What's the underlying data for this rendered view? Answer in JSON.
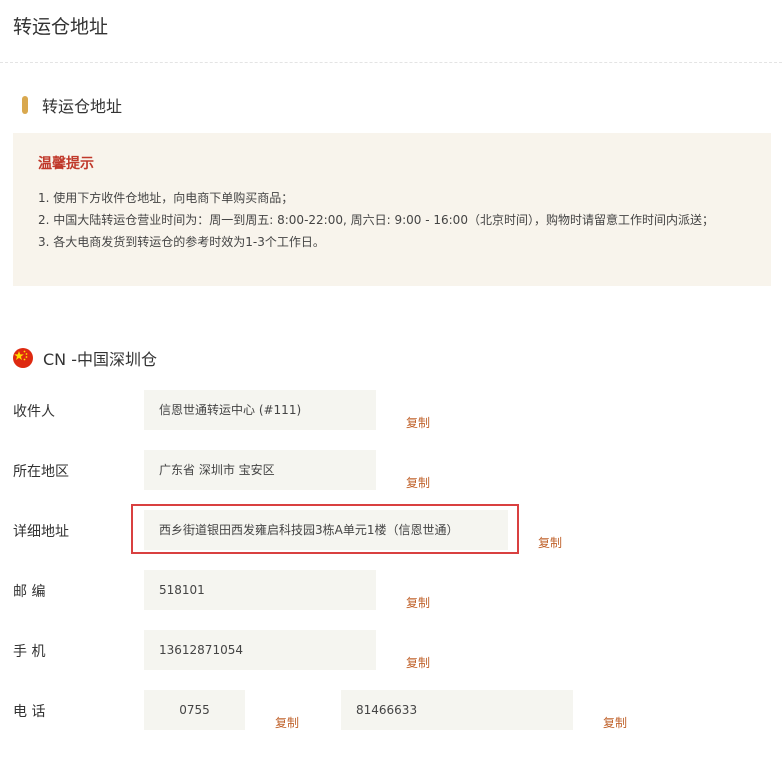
{
  "page": {
    "title": "转运仓地址"
  },
  "section": {
    "title": "转运仓地址"
  },
  "notice": {
    "title": "温馨提示",
    "lines": [
      "1. 使用下方收件仓地址，向电商下单购买商品；",
      "2. 中国大陆转运仓营业时间为：周一到周五: 8:00-22:00, 周六日: 9:00 - 16:00（北京时间），购物时请留意工作时间内派送；",
      "3. 各大电商发货到转运仓的参考时效为1-3个工作日。"
    ]
  },
  "warehouse": {
    "flag_icon": "china-flag-icon",
    "title": "CN -中国深圳仓",
    "copy_label": "复制",
    "fields": {
      "recipient": {
        "label": "收件人",
        "value": "信恩世通转运中心 (#111)"
      },
      "region": {
        "label": "所在地区",
        "value": "广东省 深圳市 宝安区"
      },
      "address": {
        "label": "详细地址",
        "value": "西乡街道银田西发雍启科技园3栋A单元1楼（信恩世通）"
      },
      "postcode": {
        "label": "邮 编",
        "value": "518101"
      },
      "mobile": {
        "label": "手 机",
        "value": "13612871054"
      },
      "phone": {
        "label": "电 话",
        "area_code": "0755",
        "number": "81466633"
      }
    }
  },
  "colors": {
    "accent": "#d9a84e",
    "notice_title": "#c0392b",
    "copy_link": "#c0622b",
    "highlight_border": "#d94040",
    "notice_background": "#f8f4ec"
  }
}
